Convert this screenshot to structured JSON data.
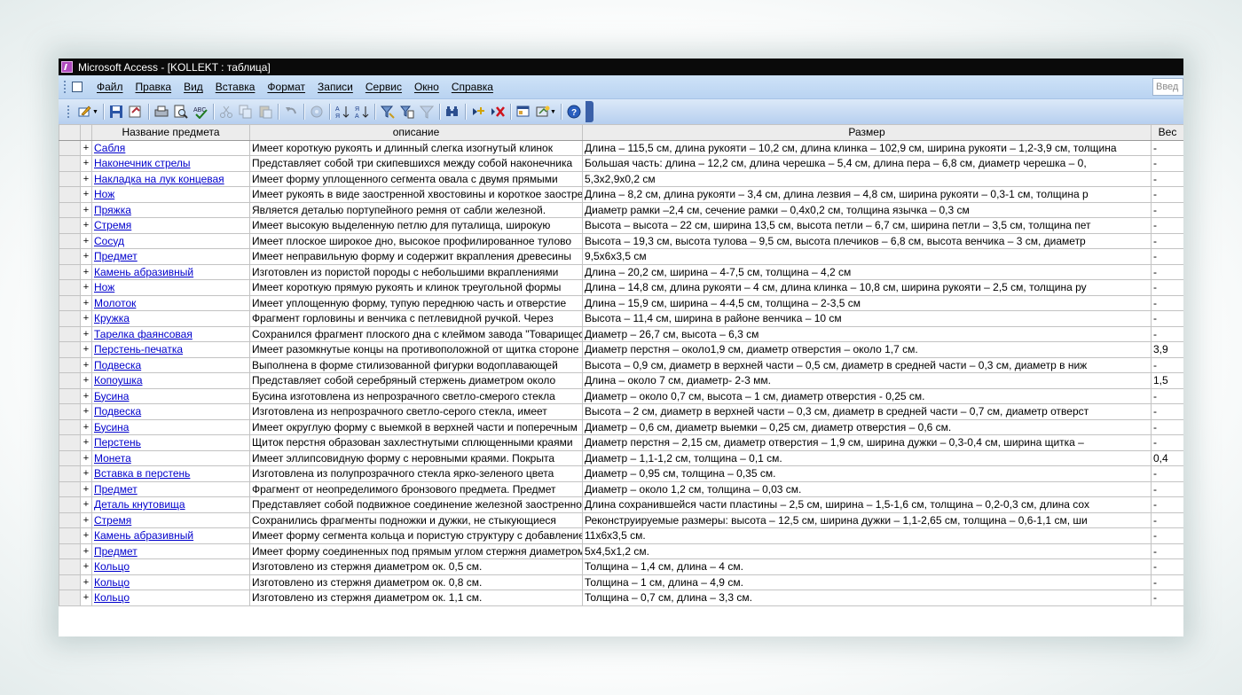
{
  "window": {
    "title": "Microsoft Access - [KOLLEKT : таблица]"
  },
  "menu": {
    "items": [
      "Файл",
      "Правка",
      "Вид",
      "Вставка",
      "Формат",
      "Записи",
      "Сервис",
      "Окно",
      "Справка"
    ],
    "ask_placeholder": "Введ"
  },
  "toolbar": {
    "buttons": [
      "view-icon",
      "save-icon",
      "db-icon",
      "print-icon",
      "preview-icon",
      "spelling-icon",
      "cut-icon",
      "copy-icon",
      "paste-icon",
      "undo-icon",
      "insert-object-icon",
      "sort-ascending-icon",
      "sort-descending-icon",
      "filter-by-selection-icon",
      "filter-by-form-icon",
      "apply-filter-icon",
      "find-icon",
      "new-record-icon",
      "delete-record-icon",
      "database-window-icon",
      "new-object-icon",
      "help-icon"
    ]
  },
  "table": {
    "columns": [
      "Название предмета",
      "описание",
      "Размер",
      "Вес"
    ],
    "rows": [
      {
        "name": "Сабля",
        "desc": "Имеет короткую рукоять и длинный слегка изогнутый клинок",
        "size": "Длина – 115,5 см, длина рукояти – 10,2 см, длина клинка – 102,9 см, ширина рукояти – 1,2-3,9 см, толщина",
        "weight": "-"
      },
      {
        "name": "Наконечник стрелы",
        "desc": "Представляет  собой три скипевшихся между собой наконечника",
        "size": "Большая часть: длина – 12,2 см, длина черешка – 5,4 см, длина пера – 6,8 см, диаметр черешка – 0,",
        "weight": "-"
      },
      {
        "name": "Накладка на лук концевая",
        "desc": "Имеет форму уплощенного сегмента овала с двумя прямыми",
        "size": "5,3х2,9х0,2 см",
        "weight": "-"
      },
      {
        "name": "Нож",
        "desc": "Имеет рукоять в виде заостренной хвостовины и короткое заостренное",
        "size": "Длина – 8,2 см, длина рукояти – 3,4 см, длина лезвия – 4,8 см, ширина рукояти – 0,3-1 см, толщина р",
        "weight": "-"
      },
      {
        "name": "Пряжка",
        "desc": "Является деталью портупейного ремня от сабли железной.",
        "size": "Диаметр рамки –2,4 см, сечение рамки – 0,4х0,2 см, толщина язычка – 0,3 см",
        "weight": "-"
      },
      {
        "name": "Стремя",
        "desc": "Имеет высокую выделенную петлю для путалища, широкую",
        "size": "Высота – высота – 22 см, ширина 13,5 см, высота петли – 6,7 см, ширина петли – 3,5 см, толщина пет",
        "weight": "-"
      },
      {
        "name": "Сосуд",
        "desc": "Имеет плоское широкое дно, высокое профилированное тулово",
        "size": "Высота – 19,3 см, высота тулова – 9,5 см, высота плечиков – 6,8 см, высота венчика – 3 см, диаметр",
        "weight": "-"
      },
      {
        "name": "Предмет",
        "desc": "Имеет неправильную форму и содержит вкрапления древесины",
        "size": "9,5х6х3,5 см",
        "weight": "-"
      },
      {
        "name": "Камень абразивный",
        "desc": "Изготовлен из пористой породы с небольшими вкраплениями",
        "size": "Длина – 20,2 см, ширина – 4-7,5 см, толщина – 4,2 см",
        "weight": "-"
      },
      {
        "name": "Нож",
        "desc": "Имеет короткую прямую рукоять и клинок треугольной формы",
        "size": "Длина – 14,8 см, длина рукояти – 4 см, длина клинка – 10,8 см, ширина рукояти – 2,5 см, толщина ру",
        "weight": "-"
      },
      {
        "name": "Молоток",
        "desc": "Имеет уплощенную форму, тупую переднюю часть и отверстие",
        "size": "Длина – 15,9 см, ширина – 4-4,5 см, толщина – 2-3,5 см",
        "weight": "-"
      },
      {
        "name": "Кружка",
        "desc": "Фрагмент горловины и венчика с петлевидной ручкой. Через",
        "size": "Высота – 11,4 см, ширина в районе венчика – 10 см",
        "weight": "-"
      },
      {
        "name": "Тарелка фаянсовая",
        "desc": "Сохранился фрагмент плоского дна с клеймом завода \"Товарищества",
        "size": "Диаметр – 26,7 см, высота – 6,3 см",
        "weight": "-"
      },
      {
        "name": "Перстень-печатка",
        "desc": "Имеет разомкнутые концы на противоположной от щитка стороне",
        "size": "Диаметр перстня – около1,9 см, диаметр отверстия – около 1,7 см.",
        "weight": "3,9"
      },
      {
        "name": "Подвеска",
        "desc": "Выполнена в форме стилизованной фигурки водоплавающей",
        "size": "Высота – 0,9 см, диаметр в верхней части – 0,5 см, диаметр в средней части – 0,3 см, диаметр в ниж",
        "weight": "-"
      },
      {
        "name": "Копоушка",
        "desc": "Представляет собой серебряный стержень диаметром около",
        "size": "Длина – около 7 см, диаметр- 2-3 мм.",
        "weight": "1,5"
      },
      {
        "name": "Бусина",
        "desc": "Бусина изготовлена из непрозрачного светло-смерого стекла",
        "size": "Диаметр – около 0,7 см, высота – 1 см, диаметр отверстия -  0,25 см.",
        "weight": "-"
      },
      {
        "name": "Подвеска",
        "desc": "Изготовлена из непрозрачного светло-серого стекла, имеет",
        "size": "Высота – 2 см, диаметр в верхней части – 0,3 см, диаметр в средней части – 0,7 см, диаметр отверст",
        "weight": "-"
      },
      {
        "name": "Бусина",
        "desc": "Имеет округлую форму с выемкой в верхней части  и поперечным",
        "size": "Диаметр – 0,6 см, диаметр выемки – 0,25 см, диаметр отверстия – 0,6 см.",
        "weight": "-"
      },
      {
        "name": "Перстень",
        "desc": "Щиток перстня образован захлестнутыми сплющенными краями",
        "size": "Диаметр перстня – 2,15 см, диаметр отверстия – 1,9 см, ширина дужки – 0,3-0,4 см, ширина щитка –",
        "weight": "-"
      },
      {
        "name": "Монета",
        "desc": "Имеет эллипсовидную форму с неровными краями. Покрыта",
        "size": "Диаметр – 1,1-1,2 см, толщина – 0,1 см.",
        "weight": "0,4"
      },
      {
        "name": "Вставка в перстень",
        "desc": "Изготовлена из полупрозрачного стекла ярко-зеленого цвета",
        "size": "Диаметр – 0,95 см, толщина – 0,35 см.",
        "weight": "-"
      },
      {
        "name": "Предмет",
        "desc": "Фрагмент от неопределимого бронзового предмета. Предмет",
        "size": "Диаметр – около 1,2 см, толщина – 0,03 см.",
        "weight": "-"
      },
      {
        "name": "Деталь кнутовища",
        "desc": "Представляет собой подвижное соединение железной заостренной",
        "size": "Длина сохранившейся части пластины – 2,5 см, ширина – 1,5-1,6 см, толщина – 0,2-0,3 см, длина сох",
        "weight": "-"
      },
      {
        "name": "Стремя",
        "desc": "Сохранились фрагменты подножки и дужки, не стыкующиеся",
        "size": "Реконструируемые размеры: высота – 12,5 см, ширина дужки – 1,1-2,65 см, толщина – 0,6-1,1 см, ши",
        "weight": "-"
      },
      {
        "name": "Камень абразивный",
        "desc": "Имеет форму сегмента кольца и пористую структуру с добавлением",
        "size": "11х6х3,5 см.",
        "weight": "-"
      },
      {
        "name": "Предмет",
        "desc": "Имеет форму соединенных под прямым углом стержня диаметром",
        "size": "5х4,5х1,2 см.",
        "weight": "-"
      },
      {
        "name": "Кольцо",
        "desc": "Изготовлено из стержня диаметром ок. 0,5 см.",
        "size": "Толщина – 1,4 см, длина – 4 см.",
        "weight": "-"
      },
      {
        "name": "Кольцо",
        "desc": "Изготовлено из стержня диаметром ок. 0,8 см.",
        "size": "Толщина – 1 см, длина – 4,9 см.",
        "weight": "-"
      },
      {
        "name": "Кольцо",
        "desc": "Изготовлено из стержня диаметром ок. 1,1 см.",
        "size": "Толщина – 0,7 см, длина – 3,3 см.",
        "weight": "-"
      }
    ]
  }
}
